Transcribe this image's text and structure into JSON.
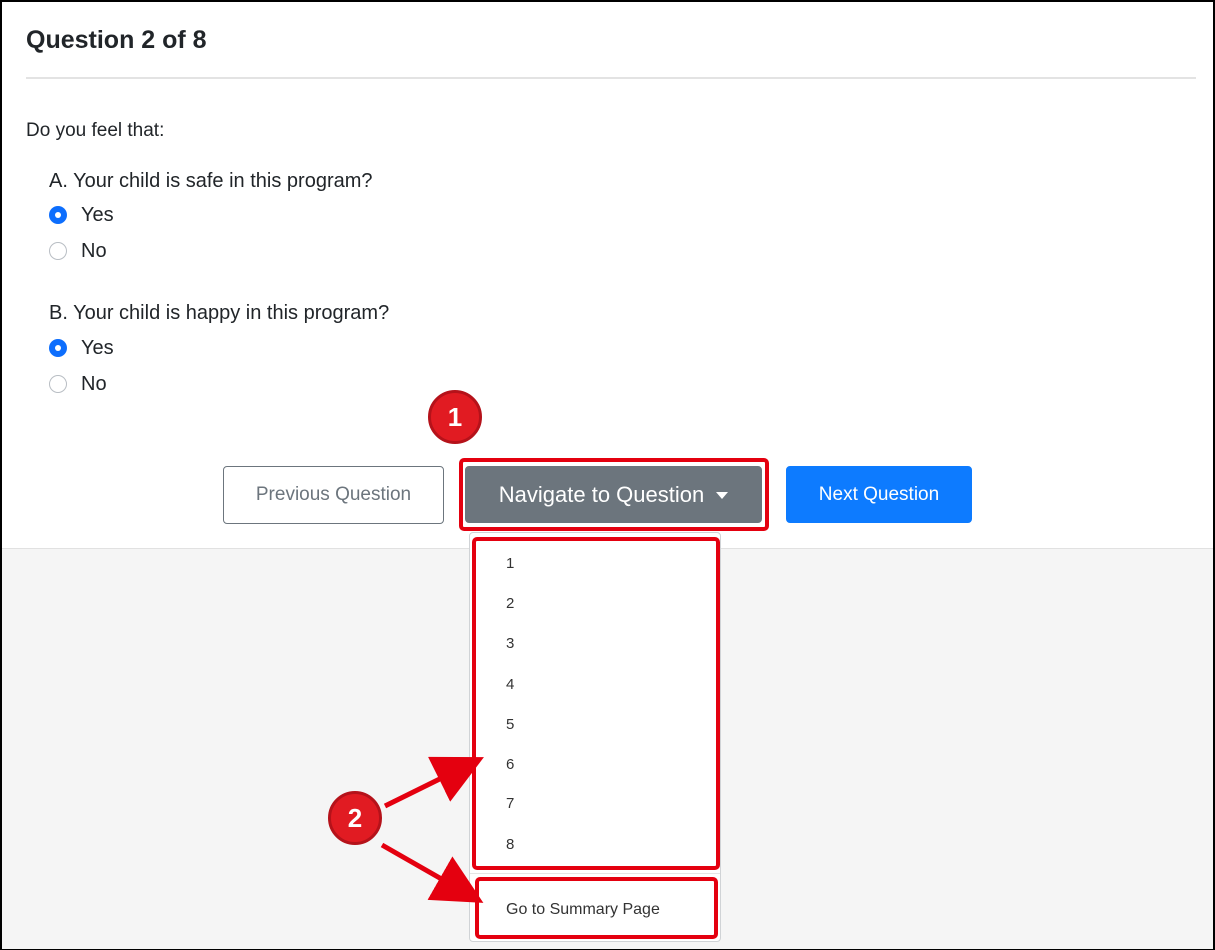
{
  "question": {
    "title": "Question 2 of 8",
    "intro": "Do you feel that:",
    "items": [
      {
        "label": "A. Your child is safe in this program?",
        "options": [
          "Yes",
          "No"
        ],
        "selected": "Yes"
      },
      {
        "label": "B. Your child is happy in this program?",
        "options": [
          "Yes",
          "No"
        ],
        "selected": "Yes"
      }
    ]
  },
  "buttons": {
    "previous": "Previous Question",
    "navigate": "Navigate to Question",
    "next": "Next Question"
  },
  "dropdown": {
    "items": [
      "1",
      "2",
      "3",
      "4",
      "5",
      "6",
      "7",
      "8"
    ],
    "summary": "Go to Summary Page"
  },
  "callouts": {
    "badge1": "1",
    "badge2": "2"
  },
  "colors": {
    "primary": "#0d7bff",
    "secondary": "#6c757d",
    "highlight": "#e4000f",
    "badge": "#e11b22",
    "page_background": "#f5f5f5"
  }
}
